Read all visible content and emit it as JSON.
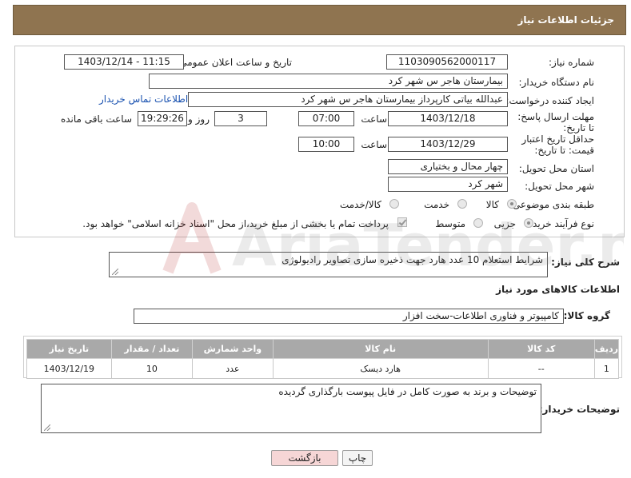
{
  "header": {
    "title": "جزئیات اطلاعات نیاز"
  },
  "form": {
    "need_number_label": "شماره نیاز:",
    "need_number_value": "1103090562000117",
    "announce_datetime_label": "تاریخ و ساعت اعلان عمومی:",
    "announce_datetime_value": "1403/12/14 - 11:15",
    "buyer_org_label": "نام دستگاه خریدار:",
    "buyer_org_value": "بیمارستان هاجر س  شهر کرد",
    "requester_label": "ایجاد کننده درخواست:",
    "requester_value": "عبدالله بیاتی کارپرداز بیمارستان هاجر س  شهر کرد",
    "contact_link": "اطلاعات تماس خریدار",
    "reply_deadline_label": "مهلت ارسال پاسخ: تا تاریخ:",
    "reply_date": "1403/12/18",
    "time_label": "ساعت",
    "reply_time": "07:00",
    "days_value": "3",
    "days_label": "روز و",
    "remaining_time": "19:29:26",
    "remaining_label": "ساعت باقی مانده",
    "price_validity_label": "حداقل تاریخ اعتبار قیمت: تا تاریخ:",
    "price_date": "1403/12/29",
    "price_time_label": "ساعت",
    "price_time": "10:00",
    "province_label": "استان محل تحویل:",
    "province_value": "چهار محال و بختیاری",
    "city_label": "شهر محل تحویل:",
    "city_value": "شهر کرد",
    "category_label": "طبقه بندی موضوعی:",
    "category_options": [
      "کالا",
      "خدمت",
      "کالا/خدمت"
    ],
    "purchase_type_label": "نوع فرآیند خرید :",
    "purchase_options": [
      "جزیی",
      "متوسط"
    ],
    "payment_note": "پرداخت تمام یا بخشی از مبلغ خرید،از محل \"اسناد خزانه اسلامی\" خواهد بود."
  },
  "description": {
    "label": "شرح کلی نیاز:",
    "value": "شرایط استعلام 10 عدد هارد جهت ذخیره سازی تصاویر رادیولوژی"
  },
  "goods_section": {
    "title": "اطلاعات کالاهای مورد نیاز",
    "group_label": "گروه کالا:",
    "group_value": "کامپیوتر و فناوری اطلاعات-سخت افزار"
  },
  "table": {
    "headers": [
      "ردیف",
      "کد کالا",
      "نام کالا",
      "واحد شمارش",
      "تعداد / مقدار",
      "تاریخ نیاز"
    ],
    "rows": [
      [
        "1",
        "--",
        "هارد دیسک",
        "عدد",
        "10",
        "1403/12/19"
      ]
    ]
  },
  "buyer_notes": {
    "label": "توضیحات خریدار:",
    "value": "توضیحات و برند به صورت کامل در فایل پیوست بارگذاری گردیده"
  },
  "buttons": {
    "back": "بازگشت",
    "print": "چاپ"
  },
  "watermark": {
    "text": "AriaTender.net"
  },
  "colors": {
    "header_bg": "#8f7450",
    "table_header_bg": "#a9a9a9",
    "link": "#1a52b0",
    "back_button": "#f6d6d6"
  }
}
